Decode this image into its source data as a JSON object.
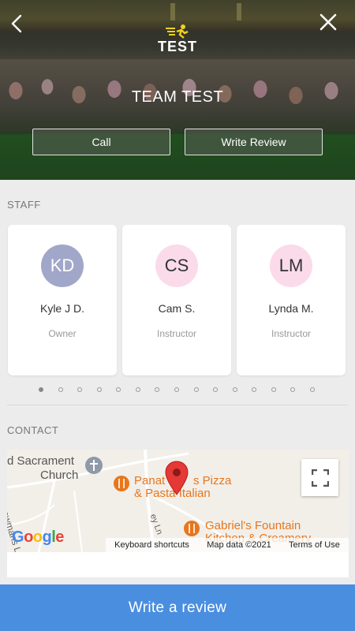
{
  "header": {
    "logo_text": "TEST",
    "team_name": "TEAM TEST",
    "call_label": "Call",
    "write_review_label": "Write Review"
  },
  "staff": {
    "section_label": "STAFF",
    "members": [
      {
        "initials": "KD",
        "name": "Kyle J D.",
        "role": "Owner",
        "color": "#a1a7c9",
        "text_color": "#ffffff"
      },
      {
        "initials": "CS",
        "name": "Cam S.",
        "role": "Instructor",
        "color": "#fbdbe9",
        "text_color": "#333333"
      },
      {
        "initials": "LM",
        "name": "Lynda M.",
        "role": "Instructor",
        "color": "#fbdbe9",
        "text_color": "#333333"
      }
    ],
    "carousel_dots": 15,
    "active_dot": 0
  },
  "contact": {
    "section_label": "CONTACT",
    "map": {
      "place_1": "d Sacrament",
      "place_1b": "Church",
      "place_2": "Panat",
      "place_2b": "s Pizza",
      "place_2c": "& Pasta Italian",
      "place_3": "Gabriel's Fountain",
      "place_3b": "Kitchen & Creamery",
      "street_1": "owmans Ln",
      "street_2": "ey Ln",
      "keyboard_shortcuts": "Keyboard shortcuts",
      "map_data": "Map data ©2021",
      "terms": "Terms of Use",
      "google": "Google"
    }
  },
  "footer": {
    "write_review_button": "Write a review"
  },
  "colors": {
    "accent": "#4a8ee0",
    "map_label_orange": "#e8761d",
    "pin_red": "#e53935"
  }
}
